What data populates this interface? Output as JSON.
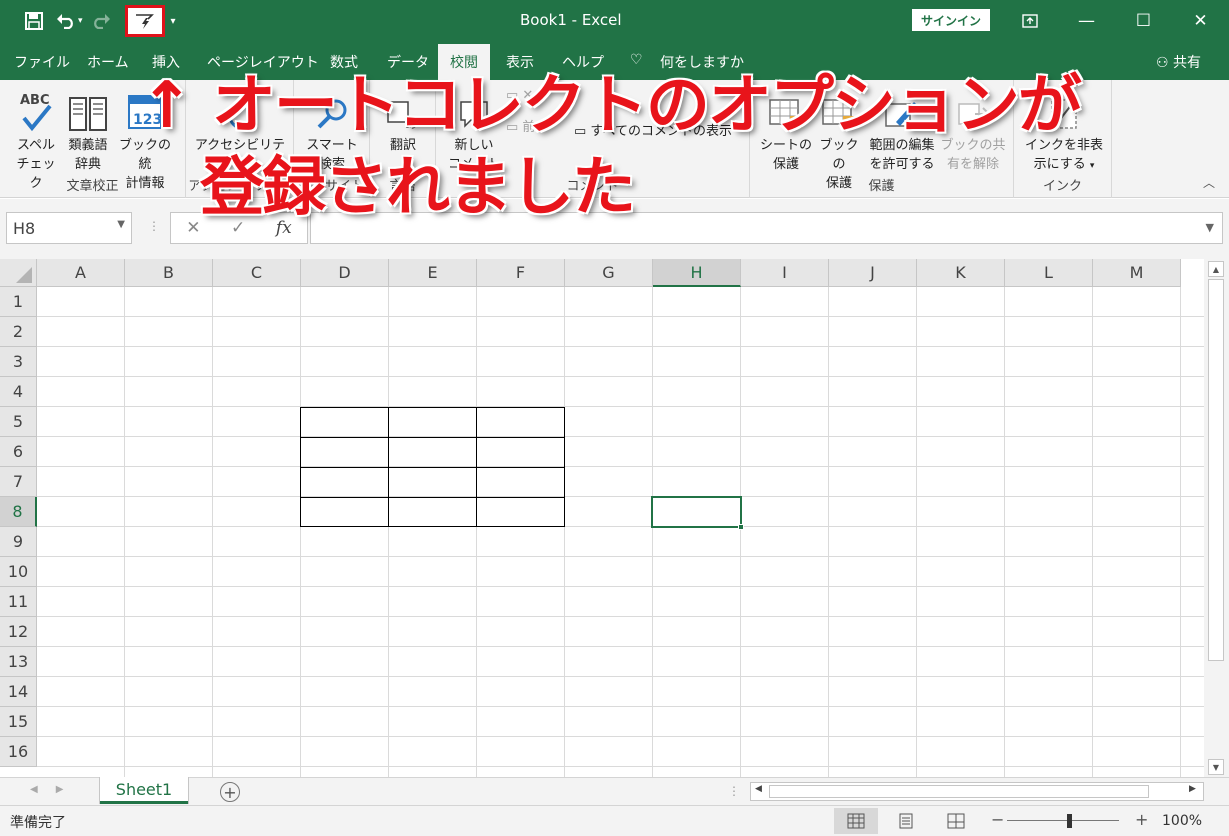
{
  "window": {
    "title": "Book1  -  Excel",
    "signin_label": "サインイン"
  },
  "qat": {
    "icons": [
      "save-icon",
      "undo-icon",
      "redo-icon",
      "autocorrect-icon",
      "customize-qat-icon"
    ]
  },
  "tabs": {
    "items": [
      "ファイル",
      "ホーム",
      "挿入",
      "ページレイアウト",
      "数式",
      "データ",
      "校閲",
      "表示",
      "ヘルプ",
      "何をしますか"
    ],
    "active": "校閲",
    "share_label": "共有"
  },
  "ribbon": {
    "proofing": {
      "label": "文章校正",
      "spell_line1": "スペル",
      "spell_line2": "チェック",
      "thesaurus_line1": "類義語",
      "thesaurus_line2": "辞典",
      "stats_line1": "ブックの統",
      "stats_line2": "計情報"
    },
    "accessibility": {
      "label": "アクセシビリティ",
      "btn": "アクセシビリティ"
    },
    "insights": {
      "label": "インサイト",
      "btn_line1": "スマート",
      "btn_line2": "検索"
    },
    "language": {
      "label": "言語",
      "btn": "翻訳"
    },
    "comments": {
      "label": "コメント",
      "new_line1": "新しい",
      "new_line2": "コメント",
      "prev": "前へ",
      "show_all": "すべてのコメントの表示"
    },
    "protect": {
      "label": "保護",
      "sheet_line1": "シートの",
      "sheet_line2": "保護",
      "book_line1": "ブックの",
      "book_line2": "保護",
      "range_line1": "範囲の編集",
      "range_line2": "を許可する",
      "unshare_line1": "ブックの共",
      "unshare_line2": "有を解除"
    },
    "ink": {
      "label": "インク",
      "btn_line1": "インクを非表",
      "btn_line2": "示にする"
    }
  },
  "formula_bar": {
    "name_box": "H8",
    "cancel": "✕",
    "enter": "✓",
    "fx": "fx",
    "value": ""
  },
  "grid": {
    "columns": [
      "A",
      "B",
      "C",
      "D",
      "E",
      "F",
      "G",
      "H",
      "I",
      "J",
      "K",
      "L",
      "M"
    ],
    "rows": [
      "1",
      "2",
      "3",
      "4",
      "5",
      "6",
      "7",
      "8",
      "9",
      "10",
      "11",
      "12",
      "13",
      "14",
      "15",
      "16"
    ],
    "selected_cell": "H8",
    "bordered_range": "D5:F8"
  },
  "sheets": {
    "tabs": [
      "Sheet1"
    ],
    "active": "Sheet1"
  },
  "status": {
    "ready": "準備完了",
    "zoom": "100%"
  },
  "annotation": {
    "line1": "↑ オートコレクトのオプションが",
    "line2": "登録されました"
  }
}
